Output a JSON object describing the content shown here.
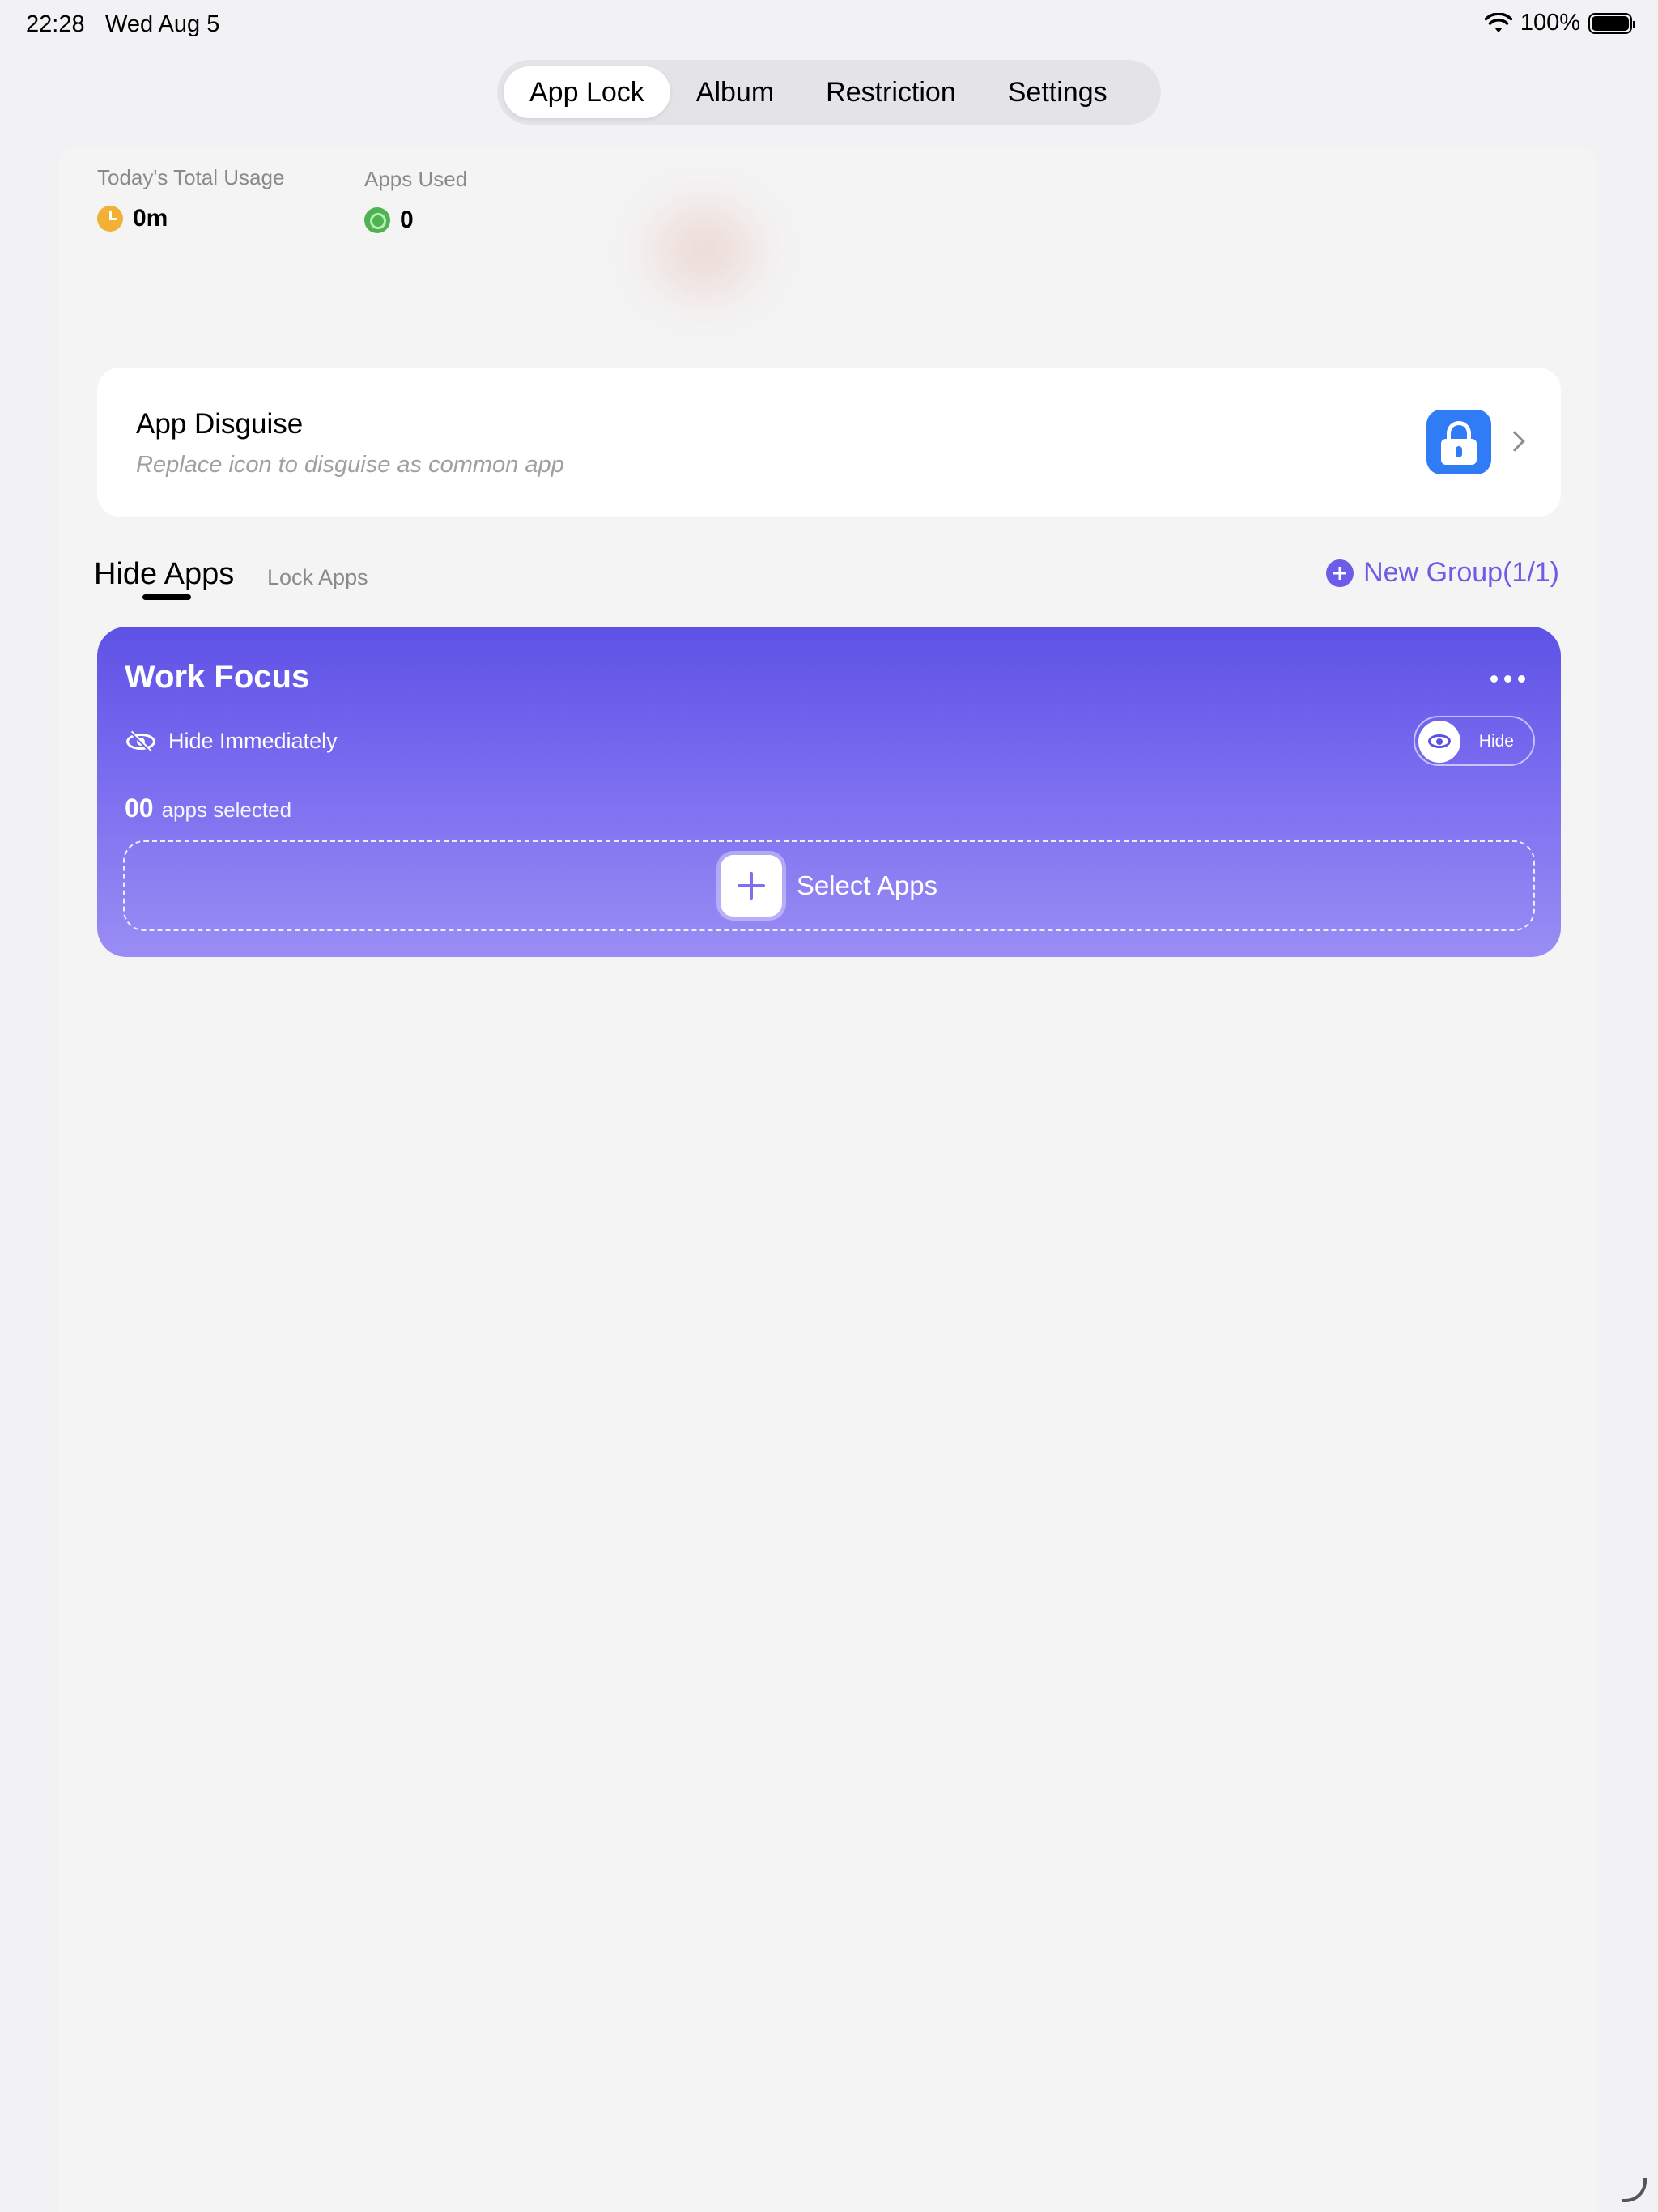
{
  "status_bar": {
    "time": "22:28",
    "date": "Wed Aug 5",
    "battery_percent": "100%"
  },
  "tabs": [
    {
      "label": "App Lock",
      "active": true
    },
    {
      "label": "Album",
      "active": false
    },
    {
      "label": "Restriction",
      "active": false
    },
    {
      "label": "Settings",
      "active": false
    }
  ],
  "stats": {
    "usage_label": "Today's Total Usage",
    "usage_value": "0m",
    "apps_used_label": "Apps Used",
    "apps_used_value": "0"
  },
  "disguise": {
    "title": "App Disguise",
    "subtitle": "Replace icon to disguise as common app",
    "icon": "lock-icon"
  },
  "section": {
    "hide_apps_label": "Hide Apps",
    "lock_apps_label": "Lock Apps",
    "new_group_label": "New Group(1/1)"
  },
  "group": {
    "title": "Work Focus",
    "hide_immediately_label": "Hide Immediately",
    "toggle_label": "Hide",
    "apps_count": "00",
    "apps_selected_text": "apps selected",
    "select_apps_label": "Select Apps"
  },
  "colors": {
    "accent": "#6c5ce7",
    "card_gradient_top": "#5e52e6",
    "card_gradient_bottom": "#998df4",
    "disguise_icon_bg": "#2f7cf6"
  }
}
